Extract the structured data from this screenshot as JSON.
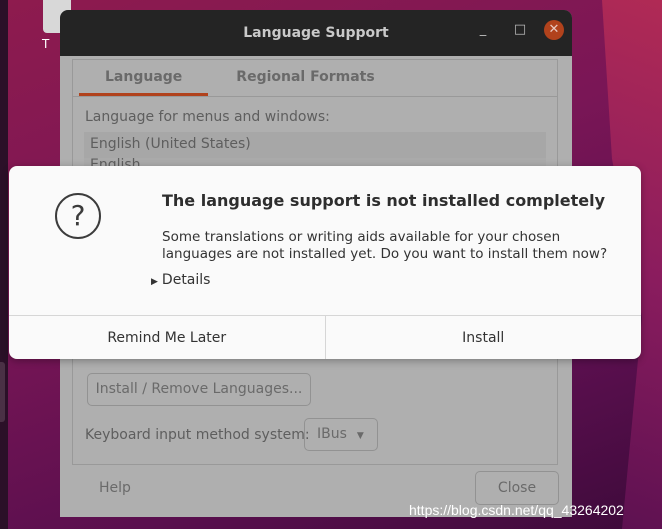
{
  "desktop": {
    "icon_label": "T",
    "watermark": "https://blog.csdn.net/qq_43264202"
  },
  "window": {
    "title": "Language Support",
    "minimize": "_",
    "maximize": "□",
    "close": "✕",
    "tabs": [
      {
        "label": "Language",
        "active": true
      },
      {
        "label": "Regional Formats",
        "active": false
      }
    ],
    "language_label": "Language for menus and windows:",
    "languages": [
      "English (United States)",
      "English"
    ],
    "install_remove_button": "Install / Remove Languages...",
    "keyboard_label": "Keyboard input method system:",
    "keyboard_value": "IBus",
    "help_button": "Help",
    "close_button": "Close"
  },
  "dialog": {
    "icon": "question-icon",
    "icon_glyph": "?",
    "heading": "The language support is not installed completely",
    "message": "Some translations or writing aids available for your chosen languages are not installed yet. Do you want to install them now?",
    "details_label": "Details",
    "remind_button": "Remind Me Later",
    "install_button": "Install"
  },
  "colors": {
    "accent": "#b1421c",
    "titlebar": "#242424"
  }
}
